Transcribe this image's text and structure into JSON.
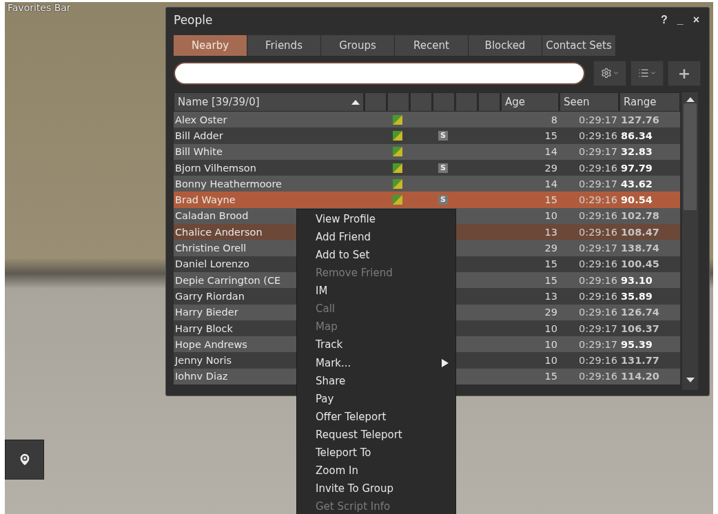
{
  "favorites_bar": {
    "label": "Favorites Bar"
  },
  "window": {
    "title": "People",
    "title_buttons": [
      "?",
      "_",
      "×"
    ]
  },
  "tabs": [
    {
      "label": "Nearby",
      "selected": true
    },
    {
      "label": "Friends",
      "selected": false
    },
    {
      "label": "Groups",
      "selected": false
    },
    {
      "label": "Recent",
      "selected": false
    },
    {
      "label": "Blocked",
      "selected": false
    },
    {
      "label": "Contact Sets",
      "selected": false
    }
  ],
  "toolbar": {
    "add_button": "+"
  },
  "table": {
    "columns": [
      {
        "kind": "name",
        "label": "Name [39/39/0]",
        "sorted": true
      },
      {
        "kind": "blank"
      },
      {
        "kind": "blank"
      },
      {
        "kind": "blank"
      },
      {
        "kind": "blank"
      },
      {
        "kind": "blank"
      },
      {
        "kind": "blank"
      },
      {
        "kind": "text",
        "label": "Age"
      },
      {
        "kind": "text",
        "label": "Seen"
      },
      {
        "kind": "text",
        "label": "Range"
      }
    ],
    "rows": [
      {
        "name": "Alex Oster",
        "status_icon": true,
        "age": "8",
        "seen": "0:29:17",
        "range": "127.76",
        "near": false,
        "selected": false,
        "hovered": false
      },
      {
        "name": "Bill Adder",
        "status_icon": true,
        "script_badge": "S",
        "age": "15",
        "seen": "0:29:16",
        "range": "86.34",
        "near": true,
        "selected": false,
        "hovered": false
      },
      {
        "name": "Bill White",
        "status_icon": true,
        "age": "14",
        "seen": "0:29:17",
        "range": "32.83",
        "near": true,
        "selected": false,
        "hovered": false
      },
      {
        "name": "Bjorn Vilhemson",
        "status_icon": true,
        "script_badge": "S",
        "age": "29",
        "seen": "0:29:16",
        "range": "97.79",
        "near": true,
        "selected": false,
        "hovered": false
      },
      {
        "name": "Bonny Heathermoore",
        "status_icon": true,
        "age": "14",
        "seen": "0:29:17",
        "range": "43.62",
        "near": true,
        "selected": false,
        "hovered": false
      },
      {
        "name": "Brad Wayne",
        "status_icon": true,
        "script_badge": "S",
        "age": "15",
        "seen": "0:29:16",
        "range": "90.54",
        "near": true,
        "selected": true,
        "hovered": false
      },
      {
        "name": "Caladan Brood",
        "age": "10",
        "seen": "0:29:16",
        "range": "102.78",
        "near": false,
        "selected": false,
        "hovered": false
      },
      {
        "name": "Chalice Anderson",
        "age": "13",
        "seen": "0:29:16",
        "range": "108.47",
        "near": false,
        "selected": false,
        "hovered": true
      },
      {
        "name": "Christine Orell",
        "age": "29",
        "seen": "0:29:17",
        "range": "138.74",
        "near": false,
        "selected": false,
        "hovered": false
      },
      {
        "name": "Daniel Lorenzo",
        "age": "15",
        "seen": "0:29:16",
        "range": "100.45",
        "near": false,
        "selected": false,
        "hovered": false
      },
      {
        "name": "Depie Carrington (CE",
        "age": "15",
        "seen": "0:29:16",
        "range": "93.10",
        "near": true,
        "selected": false,
        "hovered": false
      },
      {
        "name": "Garry Riordan",
        "age": "13",
        "seen": "0:29:16",
        "range": "35.89",
        "near": true,
        "selected": false,
        "hovered": false
      },
      {
        "name": "Harry Bieder",
        "age": "29",
        "seen": "0:29:16",
        "range": "126.74",
        "near": false,
        "selected": false,
        "hovered": false
      },
      {
        "name": "Harry Block",
        "age": "10",
        "seen": "0:29:17",
        "range": "106.37",
        "near": false,
        "selected": false,
        "hovered": false
      },
      {
        "name": "Hope Andrews",
        "age": "10",
        "seen": "0:29:17",
        "range": "95.39",
        "near": true,
        "selected": false,
        "hovered": false
      },
      {
        "name": "Jenny Noris",
        "age": "10",
        "seen": "0:29:16",
        "range": "131.77",
        "near": false,
        "selected": false,
        "hovered": false
      },
      {
        "name": "Iohnv Diaz",
        "age": "15",
        "seen": "0:29:16",
        "range": "114.20",
        "near": false,
        "selected": false,
        "hovered": false
      }
    ]
  },
  "context_menu": [
    {
      "label": "View Profile",
      "disabled": false
    },
    {
      "label": "Add Friend",
      "disabled": false
    },
    {
      "label": "Add to Set",
      "disabled": false
    },
    {
      "label": "Remove Friend",
      "disabled": true
    },
    {
      "label": "IM",
      "disabled": false
    },
    {
      "label": "Call",
      "disabled": true
    },
    {
      "label": "Map",
      "disabled": true
    },
    {
      "label": "Track",
      "disabled": false
    },
    {
      "label": "Mark...",
      "disabled": false,
      "submenu": true
    },
    {
      "label": "Share",
      "disabled": false
    },
    {
      "label": "Pay",
      "disabled": false
    },
    {
      "label": "Offer Teleport",
      "disabled": false
    },
    {
      "label": "Request Teleport",
      "disabled": false
    },
    {
      "label": "Teleport To",
      "disabled": false
    },
    {
      "label": "Zoom In",
      "disabled": false
    },
    {
      "label": "Invite To Group",
      "disabled": false
    },
    {
      "label": "Get Script Info",
      "disabled": true
    }
  ]
}
